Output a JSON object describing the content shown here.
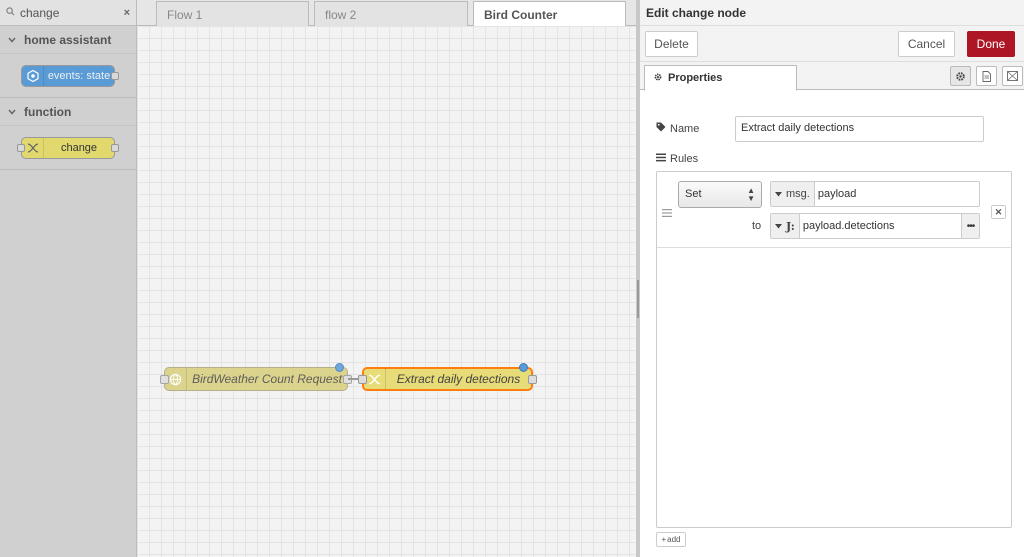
{
  "palette": {
    "search_value": "change",
    "categories": [
      {
        "label": "home assistant",
        "node": "events: state"
      },
      {
        "label": "function",
        "node": "change"
      }
    ]
  },
  "workspace": {
    "tabs": [
      "Flow 1",
      "flow 2",
      "Bird Counter"
    ],
    "active_tab": "Bird Counter",
    "nodes": [
      {
        "label": "BirdWeather Count Request"
      },
      {
        "label": "Extract daily detections"
      }
    ]
  },
  "editor": {
    "title": "Edit change node",
    "delete_label": "Delete",
    "cancel_label": "Cancel",
    "done_label": "Done",
    "tab_properties": "Properties",
    "name_label": "Name",
    "name_value": "Extract daily detections",
    "rules_label": "Rules",
    "rule": {
      "action": "Set",
      "target_type": "msg.",
      "target_value": "payload",
      "to_label": "to",
      "source_type": "J:",
      "source_value": "payload.detections"
    },
    "add_label": "add"
  },
  "colors": {
    "done_button": "#ad1625",
    "selected_node_border": "#ff7f0e",
    "change_node": "#e2d96e",
    "ha_node": "#5b9bd5"
  }
}
